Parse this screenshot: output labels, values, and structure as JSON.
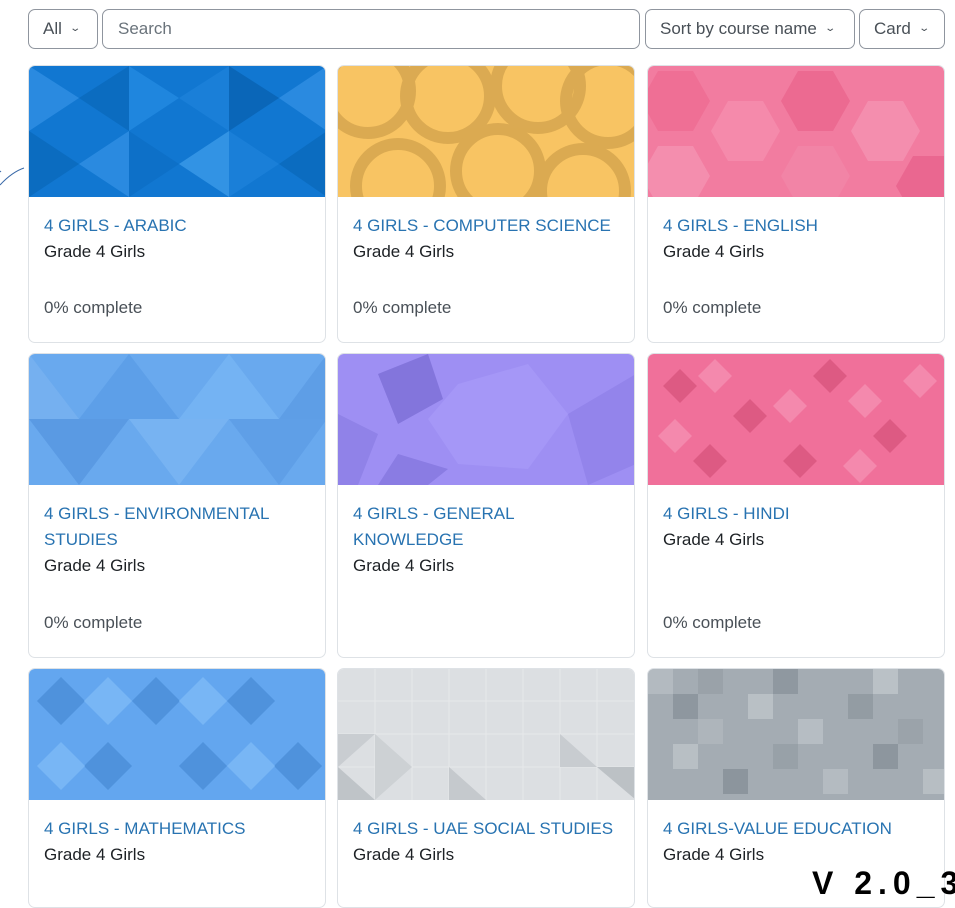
{
  "toolbar": {
    "grouping_label": "All",
    "search_placeholder": "Search",
    "sort_label": "Sort by course name",
    "view_label": "Card"
  },
  "courses": [
    {
      "name": "4 GIRLS - ARABIC",
      "category": "Grade 4 Girls",
      "progress": "0% complete",
      "color": "#1177d1"
    },
    {
      "name": "4 GIRLS - COMPUTER SCIENCE",
      "category": "Grade 4 Girls",
      "progress": "0% complete",
      "color": "#f8c463"
    },
    {
      "name": "4 GIRLS - ENGLISH",
      "category": "Grade 4 Girls",
      "progress": "0% complete",
      "color": "#f27ca0"
    },
    {
      "name": "4 GIRLS - ENVIRONMENTAL STUDIES",
      "category": "Grade 4 Girls",
      "progress": "0% complete",
      "color": "#69a9ee"
    },
    {
      "name": "4 GIRLS - GENERAL KNOWLEDGE",
      "category": "Grade 4 Girls",
      "progress": "",
      "color": "#9e8ff3"
    },
    {
      "name": "4 GIRLS - HINDI",
      "category": "Grade 4 Girls",
      "progress": "0% complete",
      "color": "#f0709a"
    },
    {
      "name": "4 GIRLS - MATHEMATICS",
      "category": "Grade 4 Girls",
      "progress": "",
      "color": "#63a6ef"
    },
    {
      "name": "4 GIRLS - UAE SOCIAL STUDIES",
      "category": "Grade 4 Girls",
      "progress": "",
      "color": "#dcdfe2"
    },
    {
      "name": "4 GIRLS-VALUE EDUCATION",
      "category": "Grade 4 Girls",
      "progress": "",
      "color": "#a4acb3"
    }
  ],
  "footer": {
    "version_text": "V 2.0_3"
  }
}
